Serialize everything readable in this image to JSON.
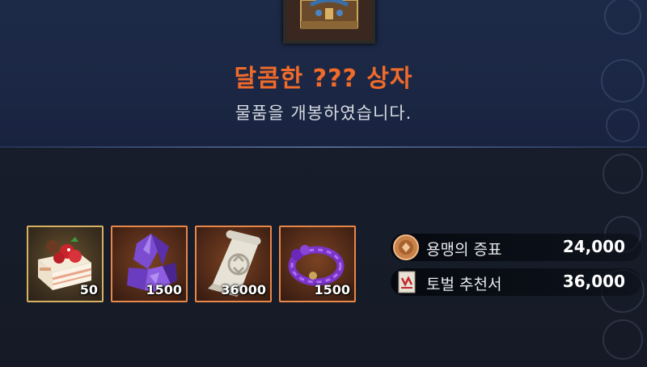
{
  "reward_popup": {
    "title": "달콤한 ??? 상자",
    "subtitle": "물품을 개봉하였습니다.",
    "chest_icon": "treasure-chest-icon"
  },
  "items": [
    {
      "icon": "strawberry-cake-icon",
      "quantity": "50",
      "rarity_color": "#d8b063"
    },
    {
      "icon": "purple-crystal-icon",
      "quantity": "1500",
      "rarity_color": "#e8874a"
    },
    {
      "icon": "scroll-icon",
      "quantity": "36000",
      "rarity_color": "#e8874a"
    },
    {
      "icon": "purple-rope-icon",
      "quantity": "1500",
      "rarity_color": "#e8874a"
    }
  ],
  "currencies": [
    {
      "icon": "bronze-medal-icon",
      "name": "용맹의 증표",
      "value": "24,000"
    },
    {
      "icon": "subjugation-letter-icon",
      "name": "토벌 추천서",
      "value": "36,000"
    }
  ],
  "colors": {
    "title": "#f06a2a",
    "background_top": "#1d2a47",
    "background_bottom": "#151a26"
  }
}
